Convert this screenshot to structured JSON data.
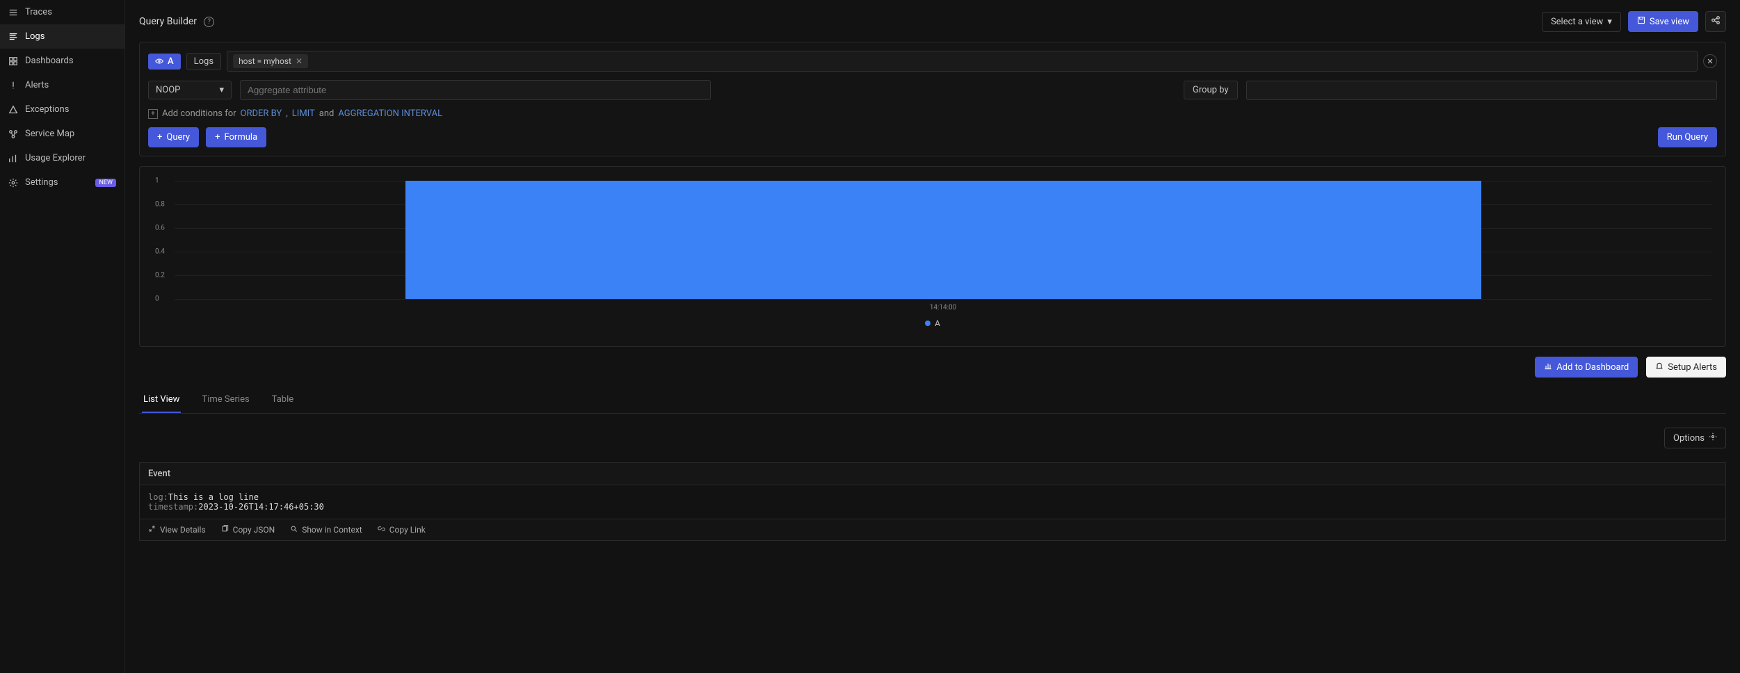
{
  "sidebar": {
    "items": [
      {
        "label": "Traces",
        "icon": "traces-icon",
        "active": false
      },
      {
        "label": "Logs",
        "icon": "logs-icon",
        "active": true
      },
      {
        "label": "Dashboards",
        "icon": "dashboards-icon",
        "active": false
      },
      {
        "label": "Alerts",
        "icon": "alerts-icon",
        "active": false
      },
      {
        "label": "Exceptions",
        "icon": "exceptions-icon",
        "active": false
      },
      {
        "label": "Service Map",
        "icon": "service-map-icon",
        "active": false
      },
      {
        "label": "Usage Explorer",
        "icon": "usage-explorer-icon",
        "active": false
      },
      {
        "label": "Settings",
        "icon": "settings-icon",
        "active": false,
        "badge": "NEW"
      }
    ]
  },
  "header": {
    "title": "Query Builder",
    "select_view_label": "Select a view",
    "save_view_label": "Save view"
  },
  "query": {
    "id_label": "A",
    "source": "Logs",
    "filter_chip": "host = myhost",
    "agg_fn": "NOOP",
    "agg_placeholder": "Aggregate attribute",
    "groupby_label": "Group by",
    "conditions_prefix": "Add conditions for",
    "cond_order": "ORDER BY",
    "cond_sep1": ",",
    "cond_limit": "LIMIT",
    "cond_and": "and",
    "cond_agg": "AGGREGATION INTERVAL",
    "add_query_label": "Query",
    "add_formula_label": "Formula",
    "run_label": "Run Query"
  },
  "chart_data": {
    "type": "bar",
    "categories": [
      "14:14:00"
    ],
    "series": [
      {
        "name": "A",
        "values": [
          1
        ]
      }
    ],
    "y_ticks": [
      0,
      0.2,
      0.4,
      0.6,
      0.8,
      1
    ],
    "ylim": [
      0,
      1
    ],
    "x_tick_label": "14:14:00",
    "legend": "A"
  },
  "dashboard_actions": {
    "add_to_dashboard": "Add to Dashboard",
    "setup_alerts": "Setup Alerts"
  },
  "tabs": {
    "items": [
      "List View",
      "Time Series",
      "Table"
    ],
    "active": "List View"
  },
  "options_label": "Options",
  "table": {
    "header": "Event",
    "row": {
      "log_key": "log:",
      "log_val": "This is a log line",
      "ts_key": "timestamp:",
      "ts_val": "2023-10-26T14:17:46+05:30"
    },
    "actions": {
      "view_details": "View Details",
      "copy_json": "Copy JSON",
      "show_context": "Show in Context",
      "copy_link": "Copy Link"
    }
  }
}
